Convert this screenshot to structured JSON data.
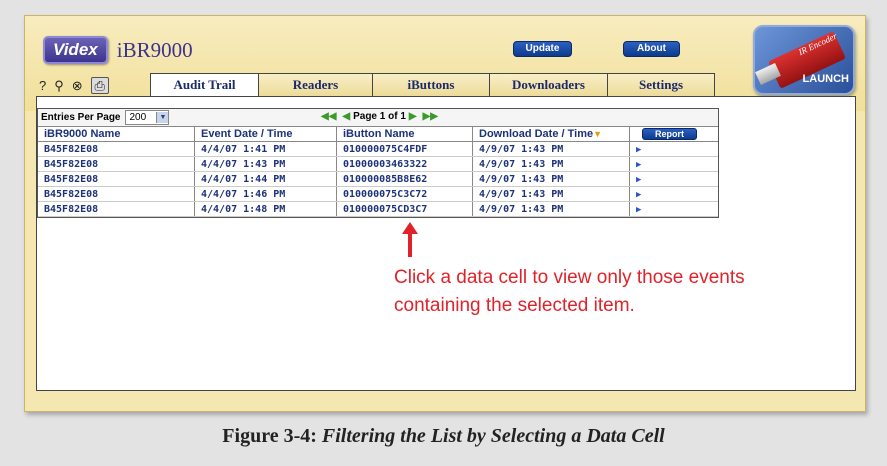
{
  "brand": {
    "logo": "Videx",
    "product": "iBR9000"
  },
  "header_buttons": {
    "update": "Update",
    "about": "About"
  },
  "launch_tile": {
    "brand": "IR Encoder",
    "label": "LAUNCH"
  },
  "toolbar_icons": [
    "help-icon",
    "search-icon",
    "clear-filter-icon",
    "print-icon"
  ],
  "toolbar_icon_glyphs": {
    "help": "?",
    "search": "⚲",
    "clear": "⊗",
    "print": "⎙"
  },
  "tabs": [
    {
      "label": "Audit Trail",
      "active": true
    },
    {
      "label": "Readers",
      "active": false
    },
    {
      "label": "iButtons",
      "active": false
    },
    {
      "label": "Downloaders",
      "active": false
    },
    {
      "label": "Settings",
      "active": false
    }
  ],
  "grid": {
    "entries_label": "Entries Per Page",
    "entries_value": "200",
    "pager_text": "Page 1 of 1",
    "columns": [
      "iBR9000 Name",
      "Event Date / Time",
      "iButton Name",
      "Download Date / Time"
    ],
    "report_label": "Report",
    "rows": [
      [
        "B45F82E08",
        "4/4/07 1:41 PM",
        "010000075C4FDF",
        "4/9/07 1:43 PM"
      ],
      [
        "B45F82E08",
        "4/4/07 1:43 PM",
        "01000003463322",
        "4/9/07 1:43 PM"
      ],
      [
        "B45F82E08",
        "4/4/07 1:44 PM",
        "010000085B8E62",
        "4/9/07 1:43 PM"
      ],
      [
        "B45F82E08",
        "4/4/07 1:46 PM",
        "010000075C3C72",
        "4/9/07 1:43 PM"
      ],
      [
        "B45F82E08",
        "4/4/07 1:48 PM",
        "010000075CD3C7",
        "4/9/07 1:43 PM"
      ]
    ]
  },
  "annotation": {
    "line1": "Click a data cell to view only those events",
    "line2": "containing the selected item."
  },
  "caption": {
    "prefix": "Figure 3-4:",
    "title": "Filtering the List by Selecting a Data Cell"
  }
}
